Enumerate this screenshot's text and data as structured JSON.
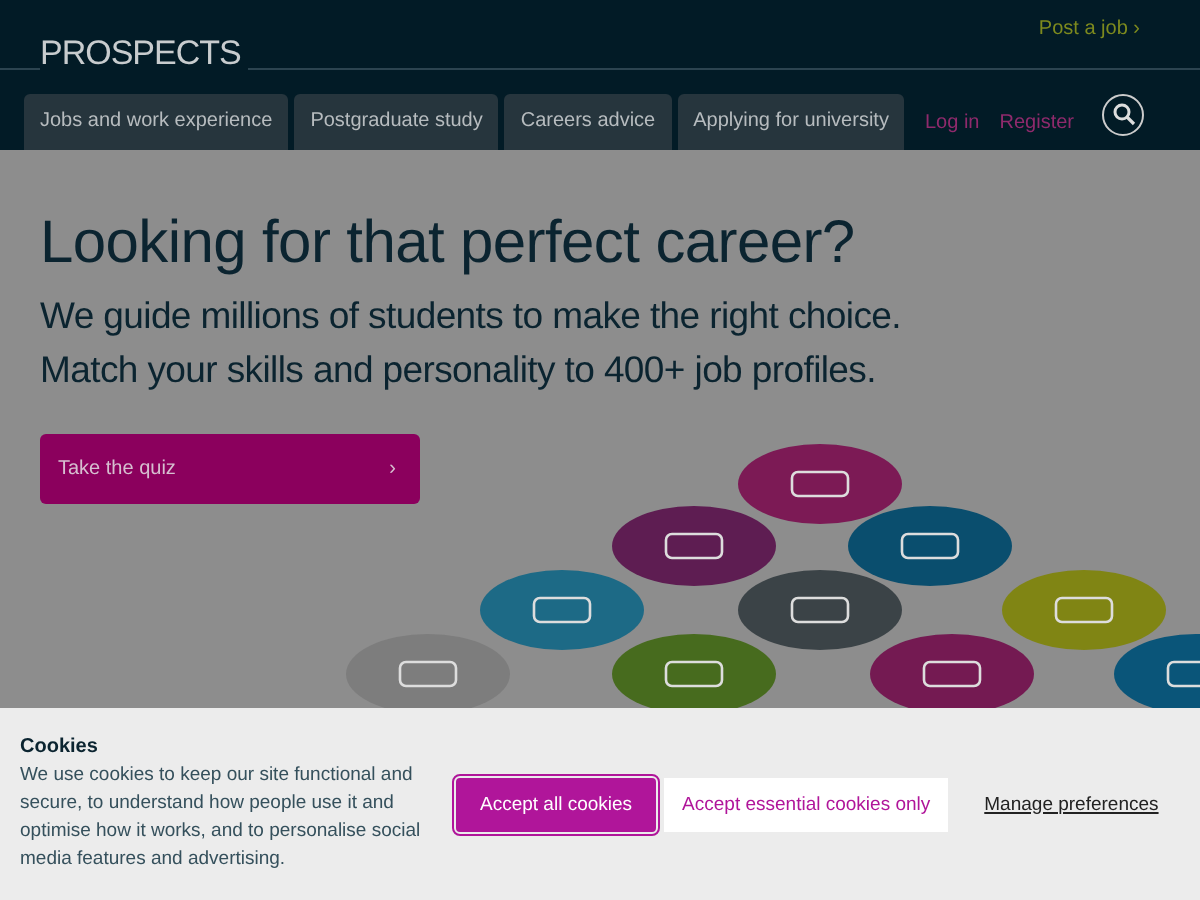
{
  "header": {
    "logo": "PROSPECTS",
    "post_job": "Post a job ›",
    "nav": [
      {
        "label": "Jobs and work experience"
      },
      {
        "label": "Postgraduate study"
      },
      {
        "label": "Careers advice"
      },
      {
        "label": "Applying for university"
      }
    ],
    "login": "Log in",
    "register": "Register"
  },
  "hero": {
    "title": "Looking for that perfect career?",
    "subtitle": [
      "We guide millions of students to make the right choice.",
      "Match your skills and personality to 400+ job profiles."
    ],
    "button": "Take the quiz",
    "button_arrow": "›"
  },
  "cookies": {
    "title": "Cookies",
    "text": "We use cookies to keep our site functional and secure, to understand how people use it and optimise how it works, and to personalise social media features and advertising.",
    "accept_all": "Accept all cookies",
    "accept_essential": "Accept essential cookies only",
    "manage": "Manage preferences"
  }
}
